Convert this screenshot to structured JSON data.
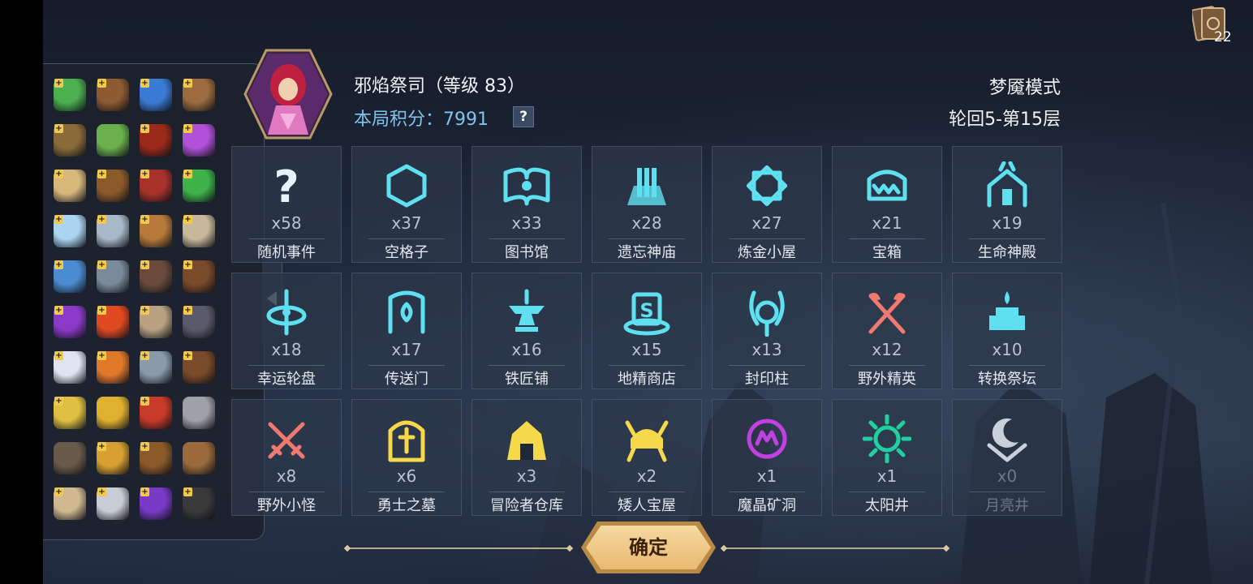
{
  "hero": {
    "name": "邪焰祭司（等级 83）",
    "score_line": "本局积分：7991",
    "help": "?"
  },
  "mode": "梦魇模式",
  "cycle": "轮回5-第15层",
  "deck_count": "22",
  "confirm_label": "确定",
  "tiles": [
    {
      "count": "x58",
      "label": "随机事件",
      "icon": "question-icon",
      "color": "#e8f2ff"
    },
    {
      "count": "x37",
      "label": "空格子",
      "icon": "hexagon-icon",
      "color": "#5fe0f0"
    },
    {
      "count": "x33",
      "label": "图书馆",
      "icon": "book-icon",
      "color": "#5fe0f0"
    },
    {
      "count": "x28",
      "label": "遗忘神庙",
      "icon": "temple-icon",
      "color": "#5fe0f0"
    },
    {
      "count": "x27",
      "label": "炼金小屋",
      "icon": "alchemy-icon",
      "color": "#5fe0f0"
    },
    {
      "count": "x21",
      "label": "宝箱",
      "icon": "chest-icon",
      "color": "#5fe0f0"
    },
    {
      "count": "x19",
      "label": "生命神殿",
      "icon": "life-shrine-icon",
      "color": "#5fe0f0"
    },
    {
      "count": "x18",
      "label": "幸运轮盘",
      "icon": "wheel-icon",
      "color": "#5fe0f0"
    },
    {
      "count": "x17",
      "label": "传送门",
      "icon": "portal-icon",
      "color": "#5fe0f0"
    },
    {
      "count": "x16",
      "label": "铁匠铺",
      "icon": "anvil-icon",
      "color": "#5fe0f0"
    },
    {
      "count": "x15",
      "label": "地精商店",
      "icon": "goblin-shop-icon",
      "color": "#5fe0f0"
    },
    {
      "count": "x13",
      "label": "封印柱",
      "icon": "seal-pillar-icon",
      "color": "#5fe0f0"
    },
    {
      "count": "x12",
      "label": "野外精英",
      "icon": "crossed-axes-icon",
      "color": "#f07a70"
    },
    {
      "count": "x10",
      "label": "转换祭坛",
      "icon": "altar-icon",
      "color": "#5fe0f0"
    },
    {
      "count": "x8",
      "label": "野外小怪",
      "icon": "crossed-swords-icon",
      "color": "#f07a70"
    },
    {
      "count": "x6",
      "label": "勇士之墓",
      "icon": "tomb-icon",
      "color": "#f5d94a"
    },
    {
      "count": "x3",
      "label": "冒险者仓库",
      "icon": "warehouse-icon",
      "color": "#f5d94a"
    },
    {
      "count": "x2",
      "label": "矮人宝屋",
      "icon": "dwarf-helmet-icon",
      "color": "#f5d94a"
    },
    {
      "count": "x1",
      "label": "魔晶矿洞",
      "icon": "crystal-mine-icon",
      "color": "#c040e0"
    },
    {
      "count": "x1",
      "label": "太阳井",
      "icon": "sun-well-icon",
      "color": "#20d0a0"
    },
    {
      "count": "x0",
      "label": "月亮井",
      "icon": "moon-well-icon",
      "color": "#c8d0dc"
    }
  ],
  "inventory": [
    {
      "icon": "green-gem-icon",
      "color": "#4caf50",
      "plus": true
    },
    {
      "icon": "belt-icon",
      "color": "#8d5a32",
      "plus": true
    },
    {
      "icon": "blue-gem-icon",
      "color": "#3a7bd5",
      "plus": true
    },
    {
      "icon": "skull-drum-icon",
      "color": "#9c6b3f",
      "plus": true
    },
    {
      "icon": "scroll-map-icon",
      "color": "#8a6a3a",
      "plus": true
    },
    {
      "icon": "green-bowl-icon",
      "color": "#6ab04c",
      "plus": false
    },
    {
      "icon": "red-rock-icon",
      "color": "#9b2a1a",
      "plus": true
    },
    {
      "icon": "purple-candle-icon",
      "color": "#b150d8",
      "plus": true
    },
    {
      "icon": "scroll-icon",
      "color": "#d8b77a",
      "plus": true
    },
    {
      "icon": "backpack-icon",
      "color": "#8b5a2b",
      "plus": true
    },
    {
      "icon": "red-book-icon",
      "color": "#a8322a",
      "plus": true
    },
    {
      "icon": "green-potion-icon",
      "color": "#3fb24a",
      "plus": true
    },
    {
      "icon": "flower-icon",
      "color": "#aad4f0",
      "plus": true
    },
    {
      "icon": "amulet-icon",
      "color": "#a8b8c8",
      "plus": true
    },
    {
      "icon": "treasure-chest-icon",
      "color": "#b87a3a",
      "plus": true
    },
    {
      "icon": "bone-skull-icon",
      "color": "#c8b89a",
      "plus": true
    },
    {
      "icon": "blue-box-icon",
      "color": "#4a8ccf",
      "plus": true
    },
    {
      "icon": "cards-icon",
      "color": "#7a8a9a",
      "plus": true
    },
    {
      "icon": "horn-icon",
      "color": "#6a4a3a",
      "plus": true
    },
    {
      "icon": "brown-book-icon",
      "color": "#7a4a2a",
      "plus": true
    },
    {
      "icon": "purple-orb-icon",
      "color": "#8b3ac8",
      "plus": true
    },
    {
      "icon": "feather-icon",
      "color": "#e04a20",
      "plus": true
    },
    {
      "icon": "skull-mask-icon",
      "color": "#b8a080",
      "plus": true
    },
    {
      "icon": "spiked-ring-icon",
      "color": "#5a5a6a",
      "plus": true
    },
    {
      "icon": "white-wing-icon",
      "color": "#e0e4f0",
      "plus": true
    },
    {
      "icon": "fire-claw-icon",
      "color": "#e0782a",
      "plus": true
    },
    {
      "icon": "hammer-icon",
      "color": "#8a9aaa",
      "plus": true
    },
    {
      "icon": "spell-book-icon",
      "color": "#7a4a2a",
      "plus": true
    },
    {
      "icon": "potions-icon",
      "color": "#e0c040",
      "plus": true
    },
    {
      "icon": "golden-key-icon",
      "color": "#e0b030",
      "plus": false
    },
    {
      "icon": "red-star-icon",
      "color": "#c83a2a",
      "plus": true
    },
    {
      "icon": "stone-skull-icon",
      "color": "#a0a0a8",
      "plus": false
    },
    {
      "icon": "tongs-icon",
      "color": "#6a5a4a",
      "plus": false
    },
    {
      "icon": "gauntlet-icon",
      "color": "#d8a030",
      "plus": true
    },
    {
      "icon": "leather-pouch-icon",
      "color": "#8b5a2b",
      "plus": true
    },
    {
      "icon": "satchel-icon",
      "color": "#9a6a3a",
      "plus": false
    },
    {
      "icon": "tattered-scroll-icon",
      "color": "#d0b890",
      "plus": true
    },
    {
      "icon": "dagger-icon",
      "color": "#c8ccd4",
      "plus": true
    },
    {
      "icon": "wizard-hat-icon",
      "color": "#7a3ac8",
      "plus": true
    },
    {
      "icon": "cauldron-icon",
      "color": "#3a3a3a",
      "plus": true
    }
  ]
}
